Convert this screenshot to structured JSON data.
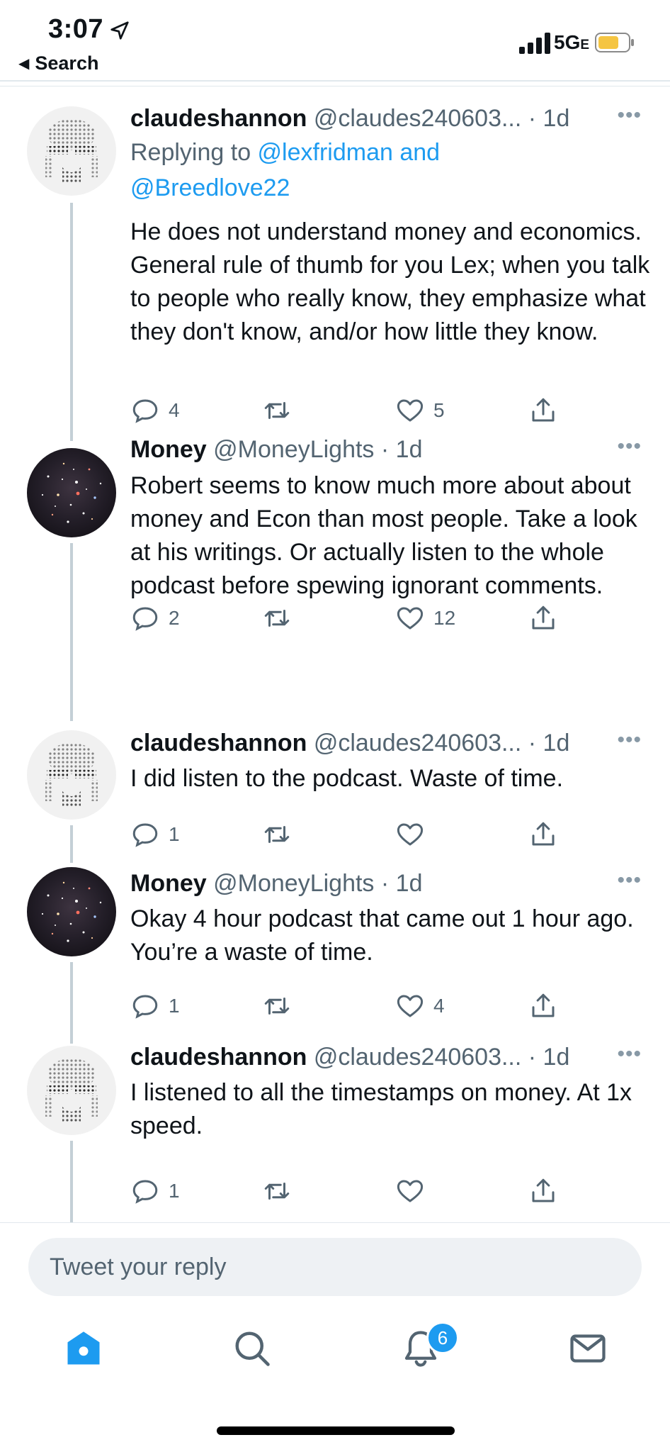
{
  "status_bar": {
    "time": "3:07",
    "back_label": "Search",
    "network": "5G",
    "network_suffix": "E"
  },
  "tweets": [
    {
      "name": "claudeshannon",
      "handle": "@claudes240603...",
      "time": "· 1d",
      "replying_prefix": "Replying to ",
      "replying_to_1": "@lexfridman and",
      "replying_to_2": "@Breedlove22",
      "text": "He does not understand money and economics. General rule of thumb for you Lex; when you talk to people who really know, they emphasize what they don't know, and/or how little they know.",
      "replies": "4",
      "retweets": "",
      "likes": "5"
    },
    {
      "name": "Money",
      "handle": "@MoneyLights",
      "time": "· 1d",
      "text": "Robert seems to know much more about about money and Econ than most people. Take a look at his writings. Or actually listen to the whole podcast before spewing ignorant comments.",
      "replies": "2",
      "retweets": "",
      "likes": "12"
    },
    {
      "name": "claudeshannon",
      "handle": "@claudes240603...",
      "time": "· 1d",
      "text": "I did listen to the podcast. Waste of time.",
      "replies": "1",
      "retweets": "",
      "likes": ""
    },
    {
      "name": "Money",
      "handle": "@MoneyLights",
      "time": "· 1d",
      "text": "Okay 4 hour podcast that came out 1 hour ago. You’re a waste of time.",
      "replies": "1",
      "retweets": "",
      "likes": "4"
    },
    {
      "name": "claudeshannon",
      "handle": "@claudes240603...",
      "time": "· 1d",
      "text": "I listened to all the timestamps on money. At 1x speed.",
      "replies": "1",
      "retweets": "",
      "likes": ""
    }
  ],
  "reply_box": {
    "placeholder": "Tweet your reply"
  },
  "tab_bar": {
    "notifications_badge": "6"
  },
  "colors": {
    "accent": "#1d9bf0",
    "text": "#0f1419",
    "secondary": "#536471",
    "thread_line": "#c4cfd6"
  },
  "icons": [
    "location-arrow-icon",
    "signal-icon",
    "battery-icon",
    "reply-icon",
    "retweet-icon",
    "like-icon",
    "share-icon",
    "more-icon",
    "home-icon",
    "search-icon",
    "bell-icon",
    "mail-icon"
  ]
}
